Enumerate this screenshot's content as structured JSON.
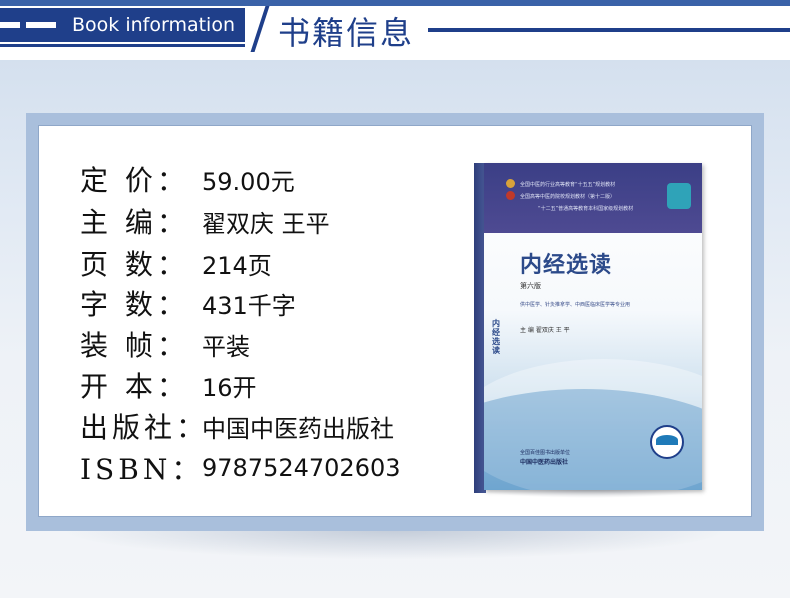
{
  "header": {
    "english_title": "Book information",
    "chinese_title": "书籍信息"
  },
  "info": {
    "rows": [
      {
        "label": "定  价：",
        "value": "59.00元"
      },
      {
        "label": "主  编：",
        "value": "翟双庆 王平"
      },
      {
        "label": "页  数：",
        "value": "214页"
      },
      {
        "label": "字  数：",
        "value": "431千字"
      },
      {
        "label": "装  帧：",
        "value": "平装"
      },
      {
        "label": "开  本：",
        "value": "16开"
      },
      {
        "label": "出版社：",
        "value": "中国中医药出版社"
      },
      {
        "label": "ISBN：",
        "value": "9787524702603"
      }
    ]
  },
  "book_cover": {
    "series_line1": "全国中医药行业高等教育“十五五”规划教材",
    "series_line2": "全国高等中医药院校规划教材（第十二版）",
    "series_line3": "“十二五”普通高等教育本科国家级规划教材",
    "title": "内经选读",
    "edition": "第六版",
    "subtitle": "供中医学、针灸推拿学、中西医临床医学等专业用",
    "editors": "主 编  翟双庆  王 平",
    "publisher_line1": "全国百佳图书出版单位",
    "publisher_line2": "中国中医药出版社",
    "vertical_title": "内经选读",
    "colors": {
      "band": "#3b3f86",
      "title": "#2c4a8a",
      "accent": "#1f3f8a"
    }
  }
}
